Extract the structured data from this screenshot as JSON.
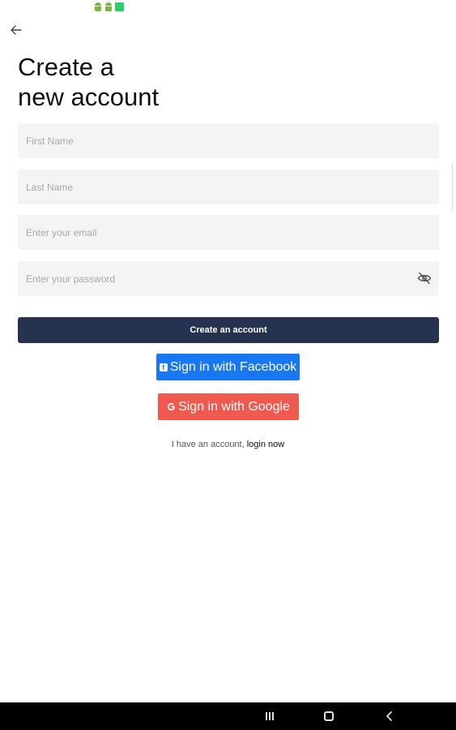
{
  "status_bar": {
    "icons": [
      "android-icon",
      "android-icon",
      "notification-square-icon"
    ],
    "colors": {
      "android": "#7cb342",
      "square": "#2ecc71"
    }
  },
  "header": {
    "back_icon": "arrow-left-icon",
    "title_line1": "Create a",
    "title_line2": "new account"
  },
  "form": {
    "first_name": {
      "placeholder": "First Name",
      "value": ""
    },
    "last_name": {
      "placeholder": "Last Name",
      "value": ""
    },
    "email": {
      "placeholder": "Enter your email",
      "value": ""
    },
    "password": {
      "placeholder": "Enter your password",
      "value": "",
      "toggle_icon": "eye-off-icon"
    },
    "submit_label": "Create an account",
    "submit_color": "#263350"
  },
  "social": {
    "facebook": {
      "label": "Sign in with Facebook",
      "icon": "facebook-icon",
      "color": "#1877f2"
    },
    "google": {
      "label": "Sign in with Google",
      "icon": "google-icon",
      "color": "#f05a4e"
    }
  },
  "footer": {
    "prompt": "I have an account,",
    "link": "login now"
  },
  "nav_bar": {
    "items": [
      "recents-icon",
      "home-icon",
      "back-icon"
    ]
  }
}
